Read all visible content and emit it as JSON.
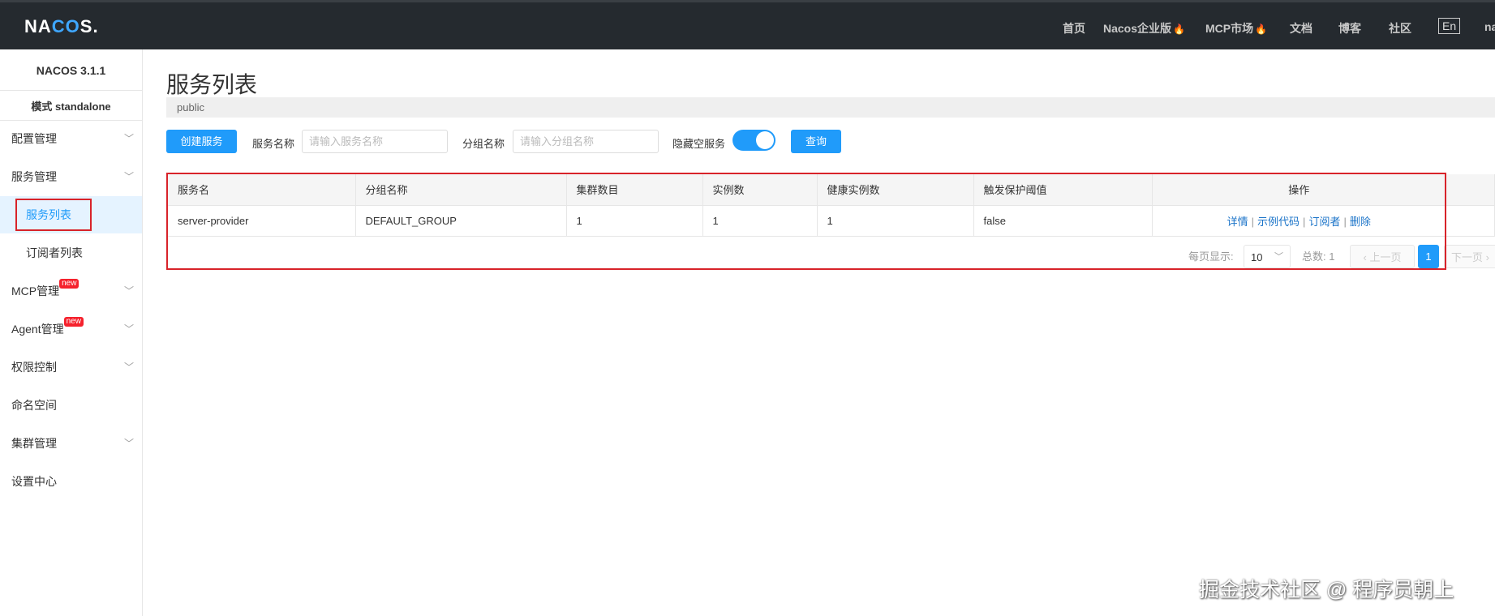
{
  "header": {
    "logo": "NACOS.",
    "nav": [
      {
        "label": "首页",
        "hot": false
      },
      {
        "label": "Nacos企业版",
        "hot": true
      },
      {
        "label": "MCP市场",
        "hot": true
      },
      {
        "label": "文档",
        "hot": false
      },
      {
        "label": "博客",
        "hot": false
      },
      {
        "label": "社区",
        "hot": false
      }
    ],
    "lang": "En",
    "user": "na"
  },
  "sidebar": {
    "version": "NACOS 3.1.1",
    "mode": "模式 standalone",
    "new_badge": "new",
    "items": [
      {
        "label": "配置管理"
      },
      {
        "label": "服务管理"
      },
      {
        "label": "服务列表"
      },
      {
        "label": "订阅者列表"
      },
      {
        "label": "MCP管理"
      },
      {
        "label": "Agent管理"
      },
      {
        "label": "权限控制"
      },
      {
        "label": "命名空间"
      },
      {
        "label": "集群管理"
      },
      {
        "label": "设置中心"
      }
    ]
  },
  "main": {
    "title": "服务列表",
    "namespace": "public",
    "toolbar": {
      "create": "创建服务",
      "service_name_label": "服务名称",
      "service_name_placeholder": "请输入服务名称",
      "group_label": "分组名称",
      "group_placeholder": "请输入分组名称",
      "hide_empty_label": "隐藏空服务",
      "hide_empty": true,
      "query": "查询"
    },
    "table": {
      "columns": [
        "服务名",
        "分组名称",
        "集群数目",
        "实例数",
        "健康实例数",
        "触发保护阈值",
        "操作"
      ],
      "rows": [
        {
          "name": "server-provider",
          "group": "DEFAULT_GROUP",
          "clusters": "1",
          "instances": "1",
          "healthy": "1",
          "threshold": "false",
          "actions": [
            "详情",
            "示例代码",
            "订阅者",
            "删除"
          ]
        }
      ]
    },
    "pagination": {
      "page_size_label": "每页显示:",
      "page_size": "10",
      "total_label": "总数:",
      "total": "1",
      "prev": "上一页",
      "current": "1",
      "next": "下一页"
    }
  },
  "watermark": "掘金技术社区 @ 程序员朝上"
}
